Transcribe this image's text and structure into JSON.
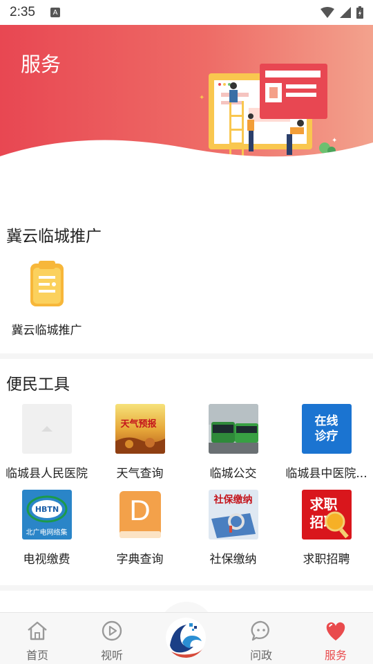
{
  "status": {
    "time": "2:35",
    "notif": "A"
  },
  "hero": {
    "title": "服务"
  },
  "section1": {
    "title": "冀云临城推广",
    "items": [
      {
        "label": "冀云临城推广",
        "icon": "clipboard-icon"
      }
    ]
  },
  "section2": {
    "title": "便民工具",
    "items": [
      {
        "label": "临城县人民医院",
        "icon": "placeholder-image"
      },
      {
        "label": "天气查询",
        "icon": "weather-forecast-image",
        "thumb_text": "天气预报"
      },
      {
        "label": "临城公交",
        "icon": "bus-image"
      },
      {
        "label": "临城县中医院...",
        "icon": "online-clinic-image",
        "thumb_text": "在线诊疗"
      },
      {
        "label": "电视缴费",
        "icon": "hbtn-logo-image",
        "thumb_text": "北广电网络集"
      },
      {
        "label": "字典查询",
        "icon": "dictionary-d-icon",
        "thumb_text": "D"
      },
      {
        "label": "社保缴纳",
        "icon": "social-security-image",
        "thumb_text": "社保缴纳"
      },
      {
        "label": "求职招聘",
        "icon": "job-recruit-image",
        "thumb_text": "求职招聘"
      }
    ]
  },
  "tabbar": {
    "tabs": [
      {
        "label": "首页",
        "icon": "home-icon"
      },
      {
        "label": "视听",
        "icon": "play-icon"
      },
      {
        "label": "问政",
        "icon": "chat-icon"
      },
      {
        "label": "服务",
        "icon": "heart-icon",
        "active": true
      }
    ]
  },
  "colors": {
    "accent": "#e94b4d",
    "hero_start": "#e84752",
    "hero_end": "#f3a28d"
  }
}
